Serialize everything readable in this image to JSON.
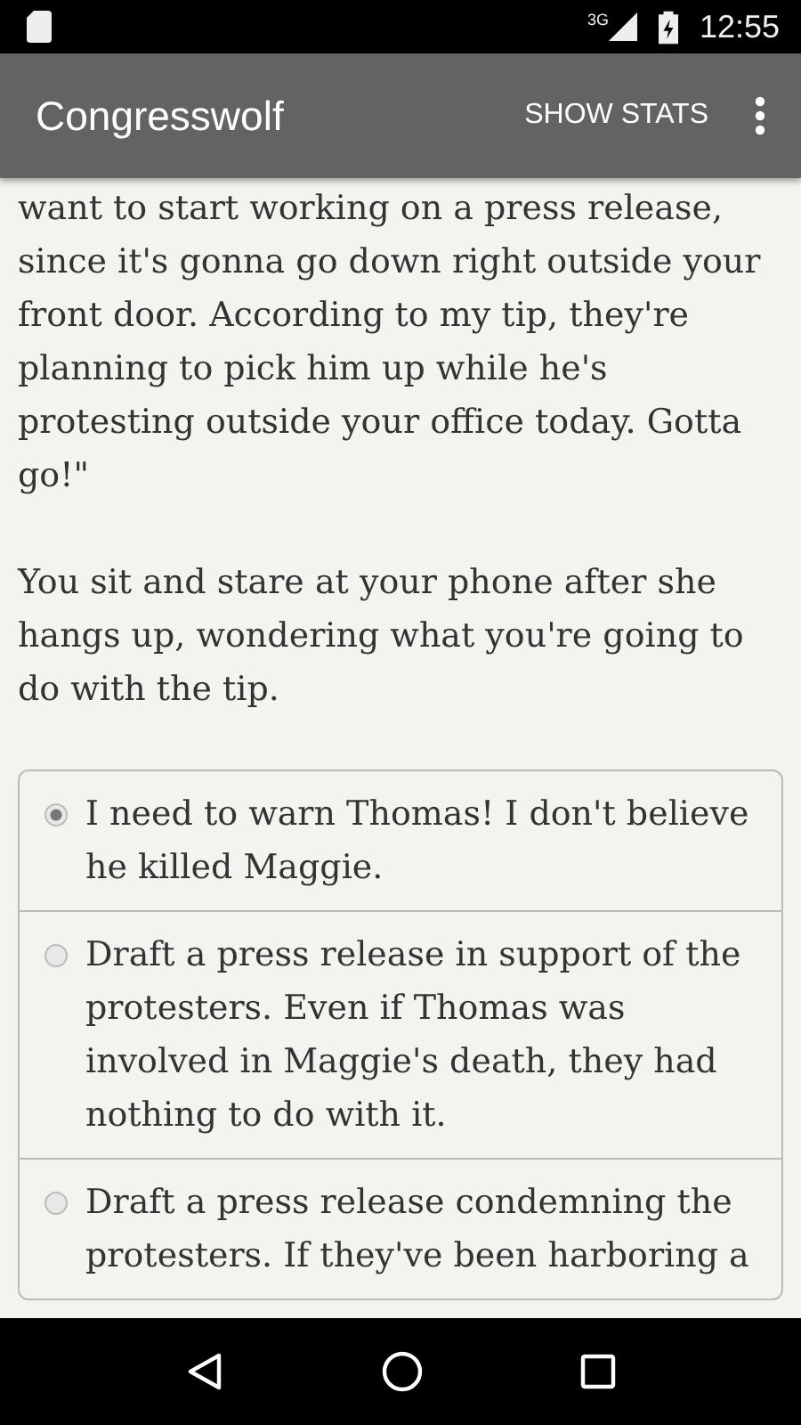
{
  "status_bar": {
    "time": "12:55",
    "network": "3G"
  },
  "app_bar": {
    "title": "Congresswolf",
    "action": "SHOW STATS"
  },
  "paragraphs": [
    "want to start working on a press release, since it's gonna go down right outside your front door. According to my tip, they're planning to pick him up while he's protesting outside your office today. Gotta go!\"",
    "You sit and stare at your phone after she hangs up, wondering what you're going to do with the tip."
  ],
  "choices": [
    {
      "text": "I need to warn Thomas! I don't believe he killed Maggie.",
      "selected": true
    },
    {
      "text": "Draft a press release in support of the protesters. Even if Thomas was involved in Maggie's death, they had nothing to do with it.",
      "selected": false
    },
    {
      "text": "Draft a press release condemning the protesters. If they've been harboring a",
      "selected": false
    }
  ]
}
